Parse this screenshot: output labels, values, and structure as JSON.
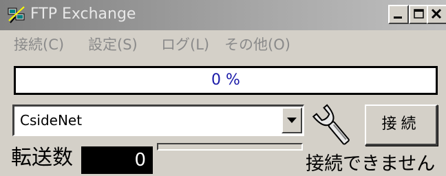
{
  "window": {
    "title": "FTP Exchange",
    "caption_buttons": [
      "minimize",
      "maximize",
      "close"
    ]
  },
  "menu": {
    "items": [
      {
        "label": "接続(C)"
      },
      {
        "label": "設定(S)"
      },
      {
        "label": "ログ(L)"
      },
      {
        "label": "その他(O)"
      }
    ]
  },
  "progress": {
    "text": "0 %",
    "color": "#1a1aa8"
  },
  "server_select": {
    "value": "CsideNet"
  },
  "connect_button": {
    "label": "接続"
  },
  "transfer": {
    "label": "転送数",
    "count": "0"
  },
  "status": {
    "text": "接続できません"
  },
  "icons": {
    "app": "network-computers-icon",
    "settings": "wrench-icon",
    "dropdown": "triangle-down-icon"
  }
}
